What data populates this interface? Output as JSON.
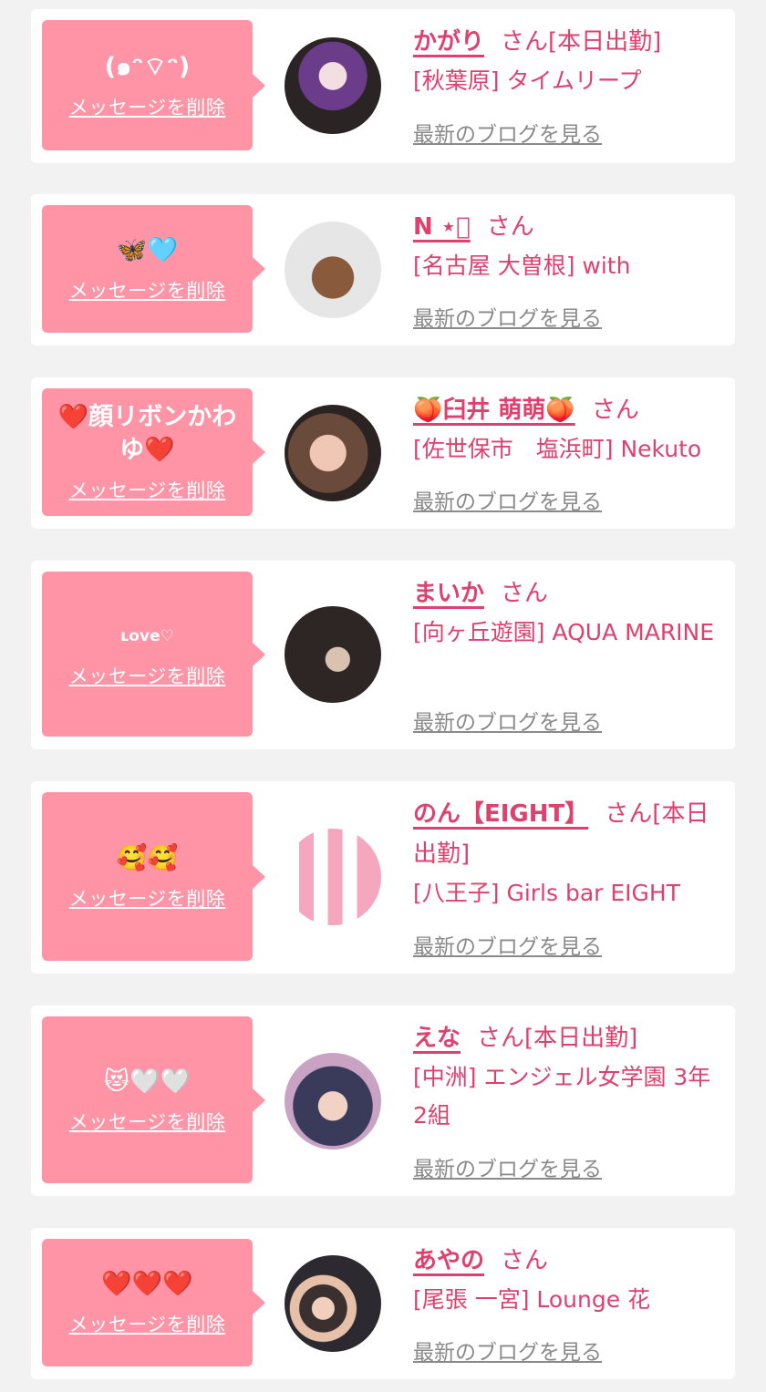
{
  "delete_label": "メッセージを削除",
  "blog_label": "最新のブログを見る",
  "suffix": "さん",
  "cards": [
    {
      "message": "(๑ᵔ⌔ᵔ)",
      "name": "かがり",
      "tag": "[本日出勤]",
      "shop": "[秋葉原] タイムリープ"
    },
    {
      "message": "🦋🩵",
      "name": "N ⋆͛",
      "tag": "",
      "shop": "[名古屋 大曽根] with"
    },
    {
      "message": "❤️顔リボンかわゆ❤️",
      "name": "🍑臼井 萌萌🍑",
      "tag": "",
      "shop": "[佐世保市　塩浜町] Nekuto"
    },
    {
      "message": "ʟove♡",
      "name": "まいか",
      "tag": "",
      "shop": "[向ヶ丘遊園] AQUA MARINE"
    },
    {
      "message": "🥰🥰",
      "name": "のん【EIGHT】",
      "tag": "[本日出勤]",
      "shop": "[八王子] Girls bar EIGHT"
    },
    {
      "message": "😻🤍🤍",
      "name": "えな",
      "tag": "[本日出勤]",
      "shop": "[中洲] エンジェル女学園 3年2組"
    },
    {
      "message": "❤️❤️❤️",
      "name": "あやの",
      "tag": "",
      "shop": "[尾張 一宮] Lounge 花"
    }
  ],
  "colors": {
    "accent": "#e0406e",
    "bubble": "#fe94a6",
    "background": "#f2f2f2"
  }
}
